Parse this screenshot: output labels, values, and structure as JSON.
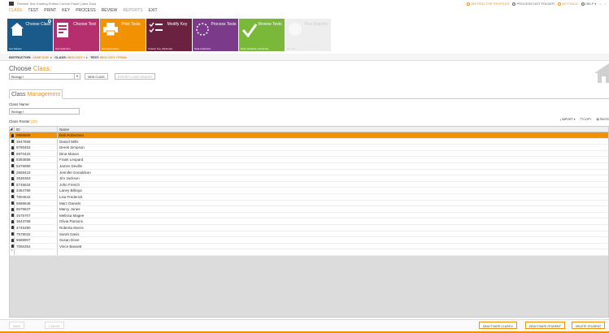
{
  "titlebar": {
    "app_title": "Remark Test Grading Edition Control Panel (Jane Doe)",
    "top_right": [
      {
        "label": "INSTRUCTOR PROFILES",
        "accent": true
      },
      {
        "label": "PROCESS HOT FOLDER",
        "accent": false
      },
      {
        "label": "SETTINGS",
        "accent": true
      },
      {
        "label": "HELP",
        "accent": false
      }
    ]
  },
  "menu": [
    "CLASS",
    "TEST",
    "PRINT",
    "KEY",
    "PROCESS",
    "REVIEW",
    "REPORTS",
    "EXIT"
  ],
  "ribbon": [
    {
      "label": "Choose Class",
      "sub": "Get Started",
      "color": "#1a5a8a",
      "icon": "home-icon"
    },
    {
      "label": "Choose Test",
      "sub": "Test Selection",
      "color": "#b52f6e",
      "icon": "test-document-icon"
    },
    {
      "label": "Print Tests",
      "sub": "Test Distribution",
      "color": "#f39200",
      "icon": "printer-icon"
    },
    {
      "label": "Modify Key",
      "sub": "Answer Key (Optional)",
      "color": "#6b2140",
      "icon": "key-list-icon"
    },
    {
      "label": "Process Tests",
      "sub": "Data Collection",
      "color": "#7b3a8a",
      "icon": "process-spinner-icon"
    },
    {
      "label": "Review Tests",
      "sub": "Data Validation (Optional)",
      "color": "#7ab83a",
      "icon": "checkmark-icon"
    },
    {
      "label": "Run Reports",
      "sub": "Reports",
      "color": "#eeeeee",
      "icon": "reports-icon"
    }
  ],
  "breadcrumb": [
    {
      "k": "INSTRUCTOR:",
      "v": "JANE DOE"
    },
    {
      "k": "CLASS:",
      "v": "BIOLOGY I"
    },
    {
      "k": "TEST:",
      "v": "BIOLOGY I FINAL"
    }
  ],
  "choose_class": {
    "title_a": "Choose ",
    "title_b": "Class:",
    "selected": "Biology I",
    "new_class": "NEW CLASS",
    "export": "EXPORT CLASS GRADES"
  },
  "tab": {
    "a": "Class ",
    "b": "Management"
  },
  "class_name": {
    "label": "Class Name:",
    "value": "Biology I"
  },
  "roster": {
    "label": "Class Roster",
    "count": "(20)",
    "tools": [
      "IMPORT",
      "COPY",
      "PASTE"
    ],
    "columns": [
      "ID",
      "Name"
    ],
    "rows": [
      {
        "id": "8658569",
        "name": "Bob Robertson",
        "selected": true
      },
      {
        "id": "3647858",
        "name": "Daniel Wills"
      },
      {
        "id": "9780453",
        "name": "Derek Simpson"
      },
      {
        "id": "5970422",
        "name": "Dina Mason"
      },
      {
        "id": "8383858",
        "name": "Frank Leopard"
      },
      {
        "id": "5375890",
        "name": "James Deville"
      },
      {
        "id": "2559423",
        "name": "Jennifer Donaldson"
      },
      {
        "id": "3636363",
        "name": "Jim Jackson"
      },
      {
        "id": "6745634",
        "name": "John French"
      },
      {
        "id": "3454788",
        "name": "Laney Billings"
      },
      {
        "id": "7804542",
        "name": "Lisa Frederick"
      },
      {
        "id": "5685848",
        "name": "Marc Daniels"
      },
      {
        "id": "8679637",
        "name": "Marcy Jones"
      },
      {
        "id": "4575707",
        "name": "Melissa Magee"
      },
      {
        "id": "3643758",
        "name": "Olivia Parsons"
      },
      {
        "id": "4745390",
        "name": "Roberta Morris"
      },
      {
        "id": "7978032",
        "name": "Sarah Davis"
      },
      {
        "id": "5588907",
        "name": "Susan Dove"
      },
      {
        "id": "7056354",
        "name": "Vince Bassett"
      }
    ],
    "new_row_marker": "*"
  },
  "footer": {
    "save": "SAVE",
    "cancel": "CANCEL",
    "deactivate_class": "DEACTIVATE CLASS",
    "deactivate_student": "DEACTIVATE STUDENT",
    "delete_student": "DELETE STUDENT"
  },
  "colors": {
    "accent": "#f39200"
  }
}
